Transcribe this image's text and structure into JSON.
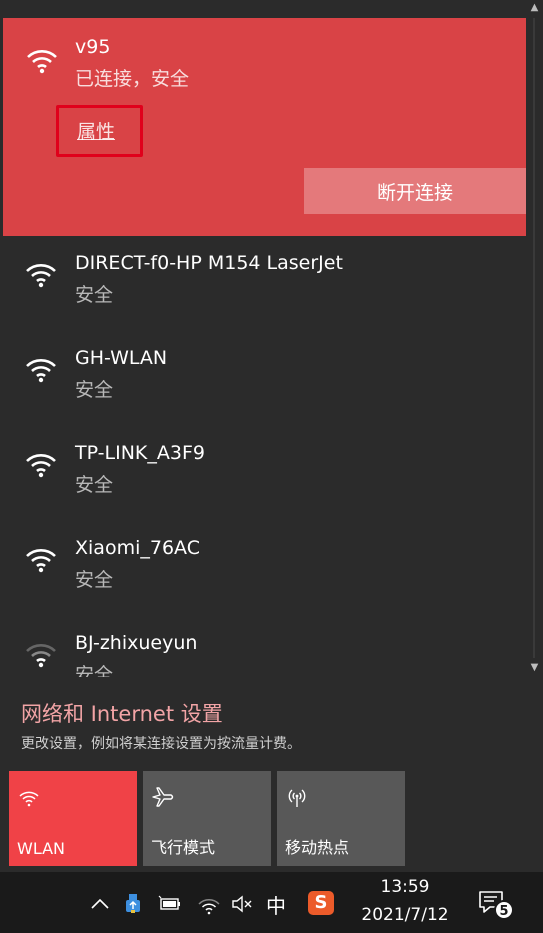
{
  "connected": {
    "name": "v95",
    "status": "已连接，安全",
    "properties_label": "属性",
    "disconnect_label": "断开连接",
    "icon": "wifi-icon"
  },
  "networks": [
    {
      "name": "DIRECT-f0-HP M154 LaserJet",
      "status": "安全",
      "icon": "wifi-icon"
    },
    {
      "name": "GH-WLAN",
      "status": "安全",
      "icon": "wifi-icon"
    },
    {
      "name": "TP-LINK_A3F9",
      "status": "安全",
      "icon": "wifi-icon"
    },
    {
      "name": "Xiaomi_76AC",
      "status": "安全",
      "icon": "wifi-icon"
    },
    {
      "name": "BJ-zhixueyun",
      "status": "安全",
      "icon": "wifi-weak-icon"
    }
  ],
  "settings": {
    "link_label": "网络和 Internet 设置",
    "description": "更改设置，例如将某连接设置为按流量计费。"
  },
  "tiles": [
    {
      "label": "WLAN",
      "icon": "wifi-icon",
      "active": true
    },
    {
      "label": "飞行模式",
      "icon": "airplane-icon",
      "active": false
    },
    {
      "label": "移动热点",
      "icon": "hotspot-icon",
      "active": false
    }
  ],
  "taskbar": {
    "ime": "中",
    "sogou": "S",
    "time": "13:59",
    "date": "2021/7/12",
    "notification_count": "5"
  },
  "colors": {
    "connected_bg": "#d94346",
    "accent": "#f04247",
    "highlight_border": "#e0001b",
    "flyout_bg": "#2b2b2b",
    "taskbar_bg": "#1a1a1a"
  }
}
